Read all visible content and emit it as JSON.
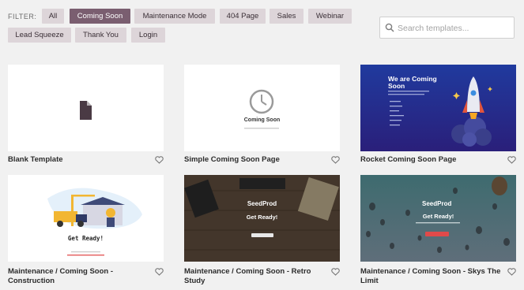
{
  "filter": {
    "label": "FILTER:",
    "chips": [
      "All",
      "Coming Soon",
      "Maintenance Mode",
      "404 Page",
      "Sales",
      "Webinar",
      "Lead Squeeze",
      "Thank You",
      "Login"
    ],
    "active": "Coming Soon"
  },
  "search": {
    "placeholder": "Search templates..."
  },
  "templates": [
    {
      "title": "Blank Template"
    },
    {
      "title": "Simple Coming Soon Page",
      "heading": "Coming Soon"
    },
    {
      "title": "Rocket Coming Soon Page",
      "heading": "We are Coming Soon"
    },
    {
      "title": "Maintenance / Coming Soon - Construction",
      "heading": "Get Ready!"
    },
    {
      "title": "Maintenance / Coming Soon - Retro Study",
      "brand": "SeedProd",
      "heading": "Get Ready!"
    },
    {
      "title": "Maintenance / Coming Soon - Skys The Limit",
      "brand": "SeedProd",
      "heading": "Get Ready!"
    }
  ],
  "colors": {
    "active_chip": "#7a5e70",
    "chip": "#ddd5d9",
    "background": "#f1f1f1",
    "rocket_bg": "#1f3fa8"
  }
}
